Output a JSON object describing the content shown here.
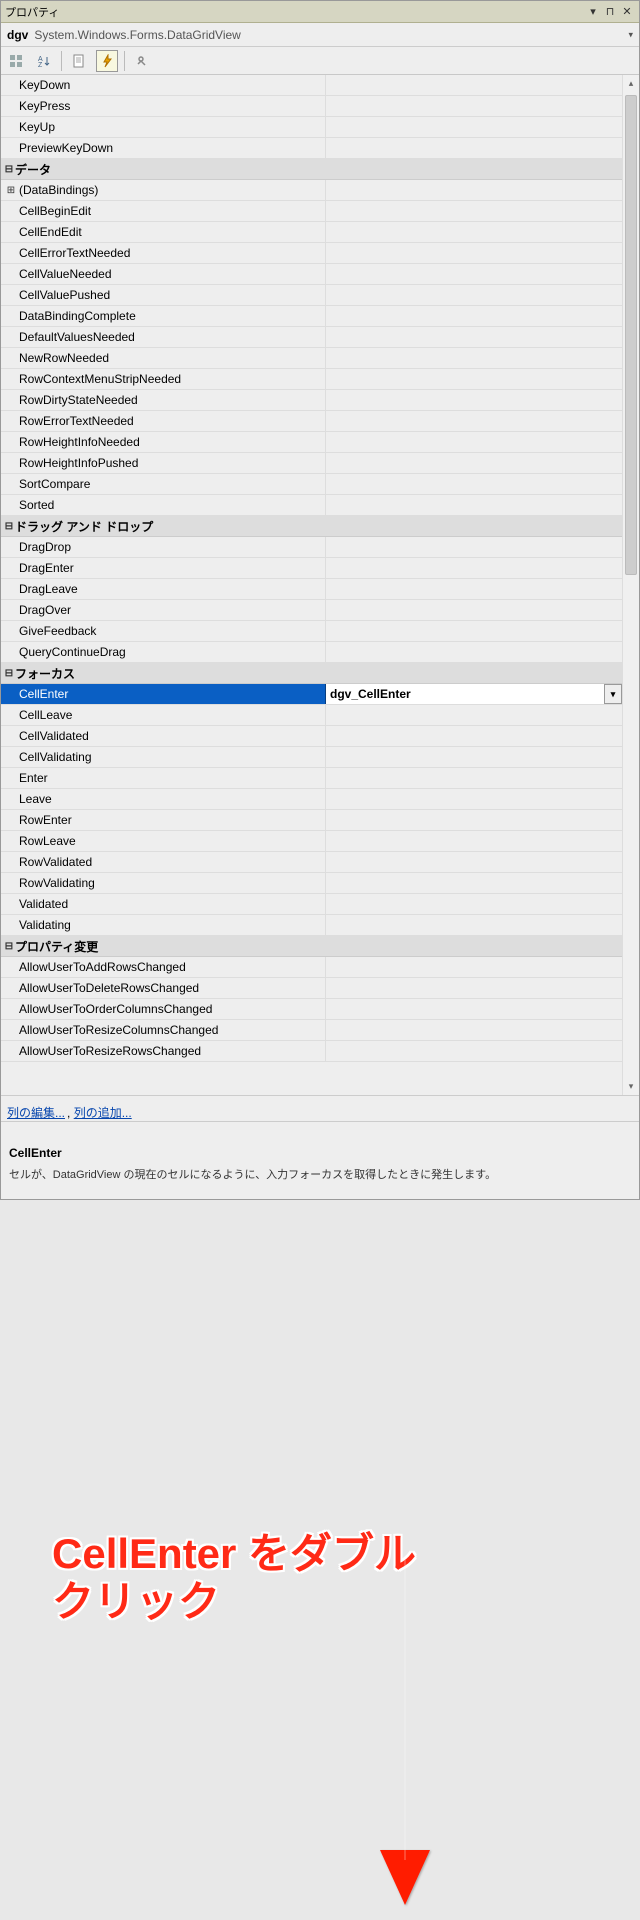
{
  "title": "プロパティ",
  "object": {
    "name": "dgv",
    "type": "System.Windows.Forms.DataGridView"
  },
  "annotation": {
    "text": "CellEnter をダブル\nクリック"
  },
  "partial_top": [
    "KeyDown",
    "KeyPress",
    "KeyUp",
    "PreviewKeyDown"
  ],
  "categories": [
    {
      "label": "データ",
      "items": [
        {
          "name": "(DataBindings)",
          "expandable": true
        },
        {
          "name": "CellBeginEdit"
        },
        {
          "name": "CellEndEdit"
        },
        {
          "name": "CellErrorTextNeeded"
        },
        {
          "name": "CellValueNeeded"
        },
        {
          "name": "CellValuePushed"
        },
        {
          "name": "DataBindingComplete"
        },
        {
          "name": "DefaultValuesNeeded"
        },
        {
          "name": "NewRowNeeded"
        },
        {
          "name": "RowContextMenuStripNeeded"
        },
        {
          "name": "RowDirtyStateNeeded"
        },
        {
          "name": "RowErrorTextNeeded"
        },
        {
          "name": "RowHeightInfoNeeded"
        },
        {
          "name": "RowHeightInfoPushed"
        },
        {
          "name": "SortCompare"
        },
        {
          "name": "Sorted"
        }
      ]
    },
    {
      "label": "ドラッグ アンド ドロップ",
      "items": [
        {
          "name": "DragDrop"
        },
        {
          "name": "DragEnter"
        },
        {
          "name": "DragLeave"
        },
        {
          "name": "DragOver"
        },
        {
          "name": "GiveFeedback"
        },
        {
          "name": "QueryContinueDrag"
        }
      ]
    },
    {
      "label": "フォーカス",
      "items": [
        {
          "name": "CellEnter",
          "selected": true,
          "value": "dgv_CellEnter"
        },
        {
          "name": "CellLeave"
        },
        {
          "name": "CellValidated"
        },
        {
          "name": "CellValidating"
        },
        {
          "name": "Enter"
        },
        {
          "name": "Leave"
        },
        {
          "name": "RowEnter"
        },
        {
          "name": "RowLeave"
        },
        {
          "name": "RowValidated"
        },
        {
          "name": "RowValidating"
        },
        {
          "name": "Validated"
        },
        {
          "name": "Validating"
        }
      ]
    },
    {
      "label": "プロパティ変更",
      "items": [
        {
          "name": "AllowUserToAddRowsChanged"
        },
        {
          "name": "AllowUserToDeleteRowsChanged"
        },
        {
          "name": "AllowUserToOrderColumnsChanged"
        },
        {
          "name": "AllowUserToResizeColumnsChanged"
        },
        {
          "name": "AllowUserToResizeRowsChanged"
        }
      ]
    }
  ],
  "commands": {
    "edit_columns": "列の編集...",
    "add_column": "列の追加...",
    "separator": ", "
  },
  "description": {
    "title": "CellEnter",
    "text": "セルが、DataGridView の現在のセルになるように、入力フォーカスを取得したときに発生します。"
  },
  "toolbar_icons": {
    "categorized": "▤",
    "alphabetical": "A↓",
    "properties": "📄",
    "events": "⚡",
    "property_pages": "🔧"
  }
}
